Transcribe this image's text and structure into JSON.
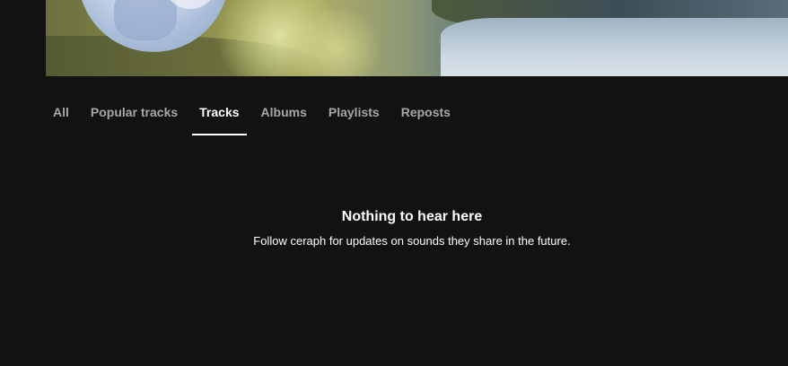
{
  "tabs": [
    {
      "label": "All",
      "active": false
    },
    {
      "label": "Popular tracks",
      "active": false
    },
    {
      "label": "Tracks",
      "active": true
    },
    {
      "label": "Albums",
      "active": false
    },
    {
      "label": "Playlists",
      "active": false
    },
    {
      "label": "Reposts",
      "active": false
    }
  ],
  "empty_state": {
    "title": "Nothing to hear here",
    "subtitle": "Follow ᴄeraph for updates on sounds they share in the future."
  },
  "colors": {
    "background": "#121212",
    "tab_inactive": "#a7a7a7",
    "tab_active": "#ffffff"
  }
}
